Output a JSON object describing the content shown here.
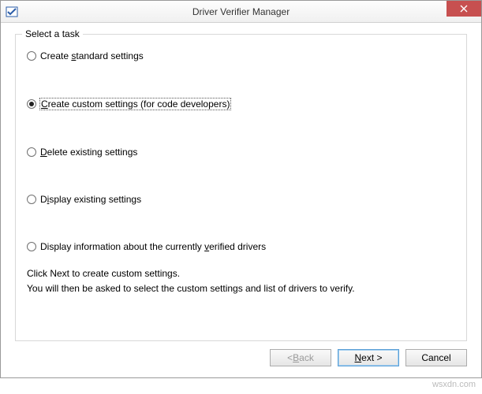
{
  "window": {
    "title": "Driver Verifier Manager"
  },
  "group": {
    "label": "Select a task"
  },
  "options": {
    "opt0": {
      "label": "Create standard settings",
      "accel": "s"
    },
    "opt1": {
      "label": "Create custom settings (for code developers)",
      "accel": "c"
    },
    "opt2": {
      "label": "Delete existing settings",
      "accel": "D"
    },
    "opt3": {
      "label": "Display existing settings",
      "accel": "i"
    },
    "opt4": {
      "label": "Display information about the currently verified drivers",
      "accel": "v"
    }
  },
  "selected_index": 1,
  "help": {
    "line1": "Click Next to create custom settings.",
    "line2": "You will then be asked to select the custom settings and list of drivers to verify."
  },
  "buttons": {
    "back": "< Back",
    "next": "Next >",
    "cancel": "Cancel"
  },
  "watermark": "wsxdn.com"
}
